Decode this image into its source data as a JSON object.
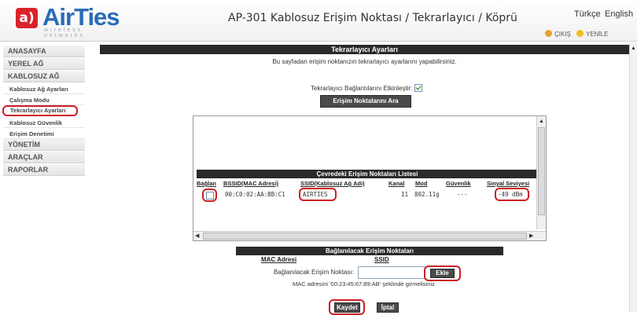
{
  "brand": {
    "logo_text": "AirTies",
    "logo_sub": "wireless networks"
  },
  "header": {
    "title": "AP-301 Kablosuz Erişim Noktası / Tekrarlayıcı / Köprü",
    "lang_tr": "Türkçe",
    "lang_en": "English",
    "exit_label": "ÇIKIŞ",
    "refresh_label": "YENİLE"
  },
  "sidebar": {
    "items": [
      {
        "label": "ANASAYFA"
      },
      {
        "label": "YEREL AĞ"
      },
      {
        "label": "KABLOSUZ AĞ"
      }
    ],
    "subitems": [
      {
        "label": "Kablosuz Ağ Ayarları"
      },
      {
        "label": "Çalışma Modu"
      },
      {
        "label": "Tekrarlayıcı Ayarları"
      },
      {
        "label": "Kablosuz Güvenlik"
      },
      {
        "label": "Erişim Denetimi"
      }
    ],
    "bottom_items": [
      {
        "label": "YÖNETİM"
      },
      {
        "label": "ARAÇLAR"
      },
      {
        "label": "RAPORLAR"
      }
    ]
  },
  "main": {
    "section_title": "Tekrarlayıcı Ayarları",
    "info_text": "Bu sayfadan erişim noktanızın tekrarlayıcı ayarlarını yapabilirsiniz.",
    "enable_label": "Tekrarlayıcı Bağlantılarını Etkinleştir:",
    "enable_checked": true,
    "search_button": "Erişim Noktalarını Ara",
    "list_title": "Çevredeki Erişim Noktaları Listesi",
    "columns": [
      "Bağlan",
      "BSSID(MAC Adresi)",
      "SSID(Kablosuz Ağ Adı)",
      "Kanal",
      "Mod",
      "Güvenlik",
      "Sinyal Seviyesi"
    ],
    "rows": [
      {
        "bssid": "00:C0:02:AA:BB:C1",
        "ssid": "AIRTIES",
        "kanal": "11",
        "mod": "802.11g",
        "guvenlik": "---",
        "sinyal": "-49 dBm"
      }
    ],
    "connect_title": "Bağlanılacak Erişim Noktaları",
    "connect_col_mac": "MAC Adresi",
    "connect_col_ssid": "SSID",
    "add_label": "Bağlanılacak Erişim Noktası:",
    "add_value": "",
    "add_button": "Ekle",
    "hint": "MAC adresini '00:23:45:67:89:AB' şeklinde girmelisiniz.",
    "save_button": "Kaydet",
    "cancel_button": "İptal"
  },
  "colors": {
    "accent_red": "#cc1f24",
    "brand_blue": "#2a6bb7",
    "bar_dark": "#2a2a2a"
  }
}
